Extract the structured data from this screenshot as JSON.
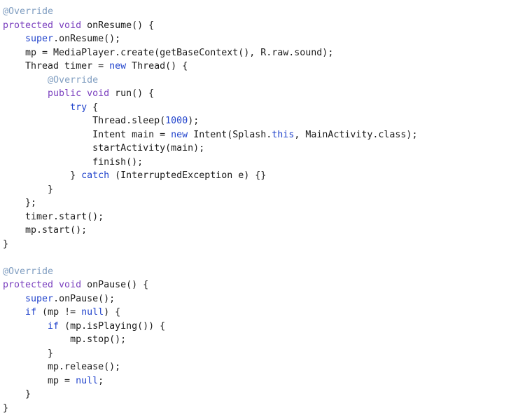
{
  "editor": {
    "language": "java",
    "background_color": "#ffffff",
    "default_text_color": "#1b1b1b",
    "token_colors": {
      "annotation": "#7f9dc0",
      "modifier": "#7a3fbe",
      "keyword": "#2244cc",
      "number": "#2244cc",
      "plain": "#1b1b1b"
    }
  },
  "code": {
    "lines": [
      {
        "tokens": [
          {
            "t": "@Override",
            "c": "annotation"
          }
        ]
      },
      {
        "tokens": [
          {
            "t": "protected void",
            "c": "modifier"
          },
          {
            "t": " onResume() {",
            "c": "plain"
          }
        ]
      },
      {
        "tokens": [
          {
            "t": "    ",
            "c": "plain"
          },
          {
            "t": "super",
            "c": "keyword"
          },
          {
            "t": ".onResume();",
            "c": "plain"
          }
        ]
      },
      {
        "tokens": [
          {
            "t": "    mp = MediaPlayer.create(getBaseContext(), R.raw.sound);",
            "c": "plain"
          }
        ]
      },
      {
        "tokens": [
          {
            "t": "    Thread timer = ",
            "c": "plain"
          },
          {
            "t": "new",
            "c": "keyword"
          },
          {
            "t": " Thread() {",
            "c": "plain"
          }
        ]
      },
      {
        "tokens": [
          {
            "t": "        ",
            "c": "plain"
          },
          {
            "t": "@Override",
            "c": "annotation"
          }
        ]
      },
      {
        "tokens": [
          {
            "t": "        ",
            "c": "plain"
          },
          {
            "t": "public void",
            "c": "modifier"
          },
          {
            "t": " run() {",
            "c": "plain"
          }
        ]
      },
      {
        "tokens": [
          {
            "t": "            ",
            "c": "plain"
          },
          {
            "t": "try",
            "c": "keyword"
          },
          {
            "t": " {",
            "c": "plain"
          }
        ]
      },
      {
        "tokens": [
          {
            "t": "                Thread.sleep(",
            "c": "plain"
          },
          {
            "t": "1000",
            "c": "number"
          },
          {
            "t": ");",
            "c": "plain"
          }
        ]
      },
      {
        "tokens": [
          {
            "t": "                Intent main = ",
            "c": "plain"
          },
          {
            "t": "new",
            "c": "keyword"
          },
          {
            "t": " Intent(Splash.",
            "c": "plain"
          },
          {
            "t": "this",
            "c": "keyword"
          },
          {
            "t": ", MainActivity.class);",
            "c": "plain"
          }
        ]
      },
      {
        "tokens": [
          {
            "t": "                startActivity(main);",
            "c": "plain"
          }
        ]
      },
      {
        "tokens": [
          {
            "t": "                finish();",
            "c": "plain"
          }
        ]
      },
      {
        "tokens": [
          {
            "t": "            } ",
            "c": "plain"
          },
          {
            "t": "catch",
            "c": "keyword"
          },
          {
            "t": " (InterruptedException e) {}",
            "c": "plain"
          }
        ]
      },
      {
        "tokens": [
          {
            "t": "        }",
            "c": "plain"
          }
        ]
      },
      {
        "tokens": [
          {
            "t": "    };",
            "c": "plain"
          }
        ]
      },
      {
        "tokens": [
          {
            "t": "    timer.start();",
            "c": "plain"
          }
        ]
      },
      {
        "tokens": [
          {
            "t": "    mp.start();",
            "c": "plain"
          }
        ]
      },
      {
        "tokens": [
          {
            "t": "}",
            "c": "plain"
          }
        ]
      },
      {
        "tokens": []
      },
      {
        "tokens": [
          {
            "t": "@Override",
            "c": "annotation"
          }
        ]
      },
      {
        "tokens": [
          {
            "t": "protected void",
            "c": "modifier"
          },
          {
            "t": " onPause() {",
            "c": "plain"
          }
        ]
      },
      {
        "tokens": [
          {
            "t": "    ",
            "c": "plain"
          },
          {
            "t": "super",
            "c": "keyword"
          },
          {
            "t": ".onPause();",
            "c": "plain"
          }
        ]
      },
      {
        "tokens": [
          {
            "t": "    ",
            "c": "plain"
          },
          {
            "t": "if",
            "c": "keyword"
          },
          {
            "t": " (mp != ",
            "c": "plain"
          },
          {
            "t": "null",
            "c": "keyword"
          },
          {
            "t": ") {",
            "c": "plain"
          }
        ]
      },
      {
        "tokens": [
          {
            "t": "        ",
            "c": "plain"
          },
          {
            "t": "if",
            "c": "keyword"
          },
          {
            "t": " (mp.isPlaying()) {",
            "c": "plain"
          }
        ]
      },
      {
        "tokens": [
          {
            "t": "            mp.stop();",
            "c": "plain"
          }
        ]
      },
      {
        "tokens": [
          {
            "t": "        }",
            "c": "plain"
          }
        ]
      },
      {
        "tokens": [
          {
            "t": "        mp.release();",
            "c": "plain"
          }
        ]
      },
      {
        "tokens": [
          {
            "t": "        mp = ",
            "c": "plain"
          },
          {
            "t": "null",
            "c": "keyword"
          },
          {
            "t": ";",
            "c": "plain"
          }
        ]
      },
      {
        "tokens": [
          {
            "t": "    }",
            "c": "plain"
          }
        ]
      },
      {
        "tokens": [
          {
            "t": "}",
            "c": "plain"
          }
        ]
      }
    ]
  }
}
